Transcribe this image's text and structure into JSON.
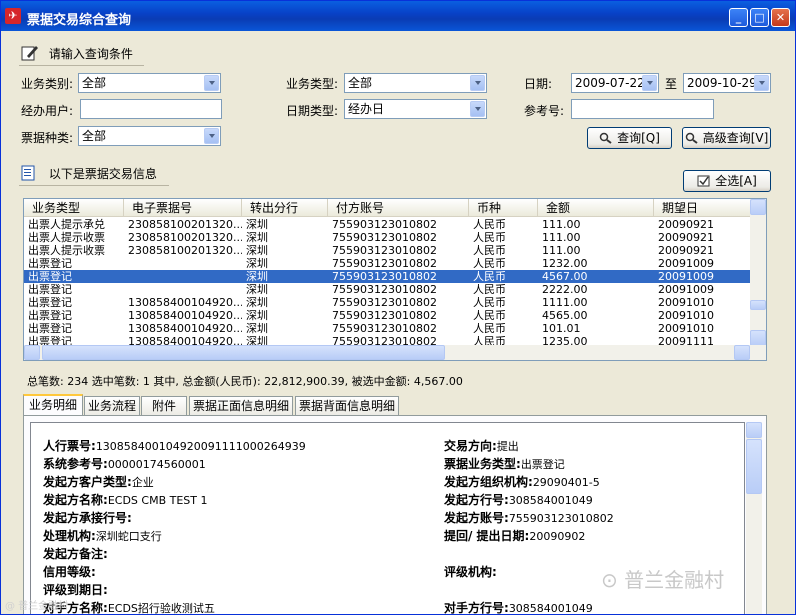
{
  "window": {
    "title": "票据交易综合查询",
    "icon_glyph": "✈"
  },
  "query": {
    "section_title": "请输入查询条件",
    "biz_category_label": "业务类别:",
    "biz_category_value": "全部",
    "handler_label": "经办用户:",
    "bill_type_label": "票据种类:",
    "bill_type_value": "全部",
    "biz_type_label": "业务类型:",
    "biz_type_value": "全部",
    "date_type_label": "日期类型:",
    "date_type_value": "经办日",
    "date_label": "日期:",
    "date_from": "2009-07-22",
    "date_to_sep": "至",
    "date_to": "2009-10-29",
    "ref_label": "参考号:",
    "query_btn": "查询[Q]",
    "adv_query_btn": "高级查询[V]"
  },
  "list": {
    "section_title": "以下是票据交易信息",
    "select_all_btn": "全选[A]",
    "columns": [
      "业务类型",
      "电子票据号",
      "转出分行",
      "付方账号",
      "币种",
      "金额",
      "期望日"
    ],
    "rows": [
      [
        "出票人提示承兑",
        "230858100201320...",
        "深圳",
        "755903123010802",
        "人民币",
        "111.00",
        "20090921"
      ],
      [
        "出票人提示收票",
        "230858100201320...",
        "深圳",
        "755903123010802",
        "人民币",
        "111.00",
        "20090921"
      ],
      [
        "出票人提示收票",
        "230858100201320...",
        "深圳",
        "755903123010802",
        "人民币",
        "111.00",
        "20090921"
      ],
      [
        "出票登记",
        "",
        "深圳",
        "755903123010802",
        "人民币",
        "1232.00",
        "20091009"
      ],
      [
        "出票登记",
        "",
        "深圳",
        "755903123010802",
        "人民币",
        "4567.00",
        "20091009"
      ],
      [
        "出票登记",
        "",
        "深圳",
        "755903123010802",
        "人民币",
        "2222.00",
        "20091009"
      ],
      [
        "出票登记",
        "130858400104920...",
        "深圳",
        "755903123010802",
        "人民币",
        "1111.00",
        "20091010"
      ],
      [
        "出票登记",
        "130858400104920...",
        "深圳",
        "755903123010802",
        "人民币",
        "4565.00",
        "20091010"
      ],
      [
        "出票登记",
        "130858400104920...",
        "深圳",
        "755903123010802",
        "人民币",
        "101.01",
        "20091010"
      ],
      [
        "出票登记",
        "130858400104920...",
        "深圳",
        "755903123010802",
        "人民币",
        "1235.00",
        "20091111"
      ]
    ],
    "selected_row": 4,
    "summary": "总笔数: 234  选中笔数: 1  其中, 总金额(人民币): 22,812,900.39, 被选中金额: 4,567.00"
  },
  "tabs": [
    "业务明细",
    "业务流程",
    "附件",
    "票据正面信息明细",
    "票据背面信息明细"
  ],
  "detail": {
    "left": [
      {
        "label": "人行票号:",
        "value": "130858400104920091111000264939"
      },
      {
        "label": "系统参考号:",
        "value": "00000174560001"
      },
      {
        "label": "发起方客户类型:",
        "value": "企业"
      },
      {
        "label": "发起方名称:",
        "value": "ECDS CMB TEST 1"
      },
      {
        "label": "发起方承接行号:",
        "value": ""
      },
      {
        "label": "处理机构:",
        "value": "深圳蛇口支行"
      },
      {
        "label": "发起方备注:",
        "value": ""
      },
      {
        "label": "信用等级:",
        "value": ""
      },
      {
        "label": "评级到期日:",
        "value": ""
      },
      {
        "label": "对手方名称:",
        "value": "ECDS招行验收测试五"
      }
    ],
    "right": [
      {
        "label": "交易方向:",
        "value": "提出"
      },
      {
        "label": "票据业务类型:",
        "value": "出票登记"
      },
      {
        "label": "发起方组织机构:",
        "value": "29090401-5"
      },
      {
        "label": "发起方行号:",
        "value": "308584001049"
      },
      {
        "label": "发起方账号:",
        "value": "755903123010802"
      },
      {
        "label": "提回/ 提出日期:",
        "value": "20090902"
      },
      {
        "label": "评级机构:",
        "value": ""
      },
      {
        "label": "对手方行号:",
        "value": "308584001049"
      }
    ]
  },
  "watermark": {
    "text": "普兰金融村",
    "corner": "@ 普兰金融村"
  },
  "colors": {
    "titlebar": "#0A46CC",
    "selection": "#316AC5",
    "window_bg": "#ECE9D8"
  }
}
